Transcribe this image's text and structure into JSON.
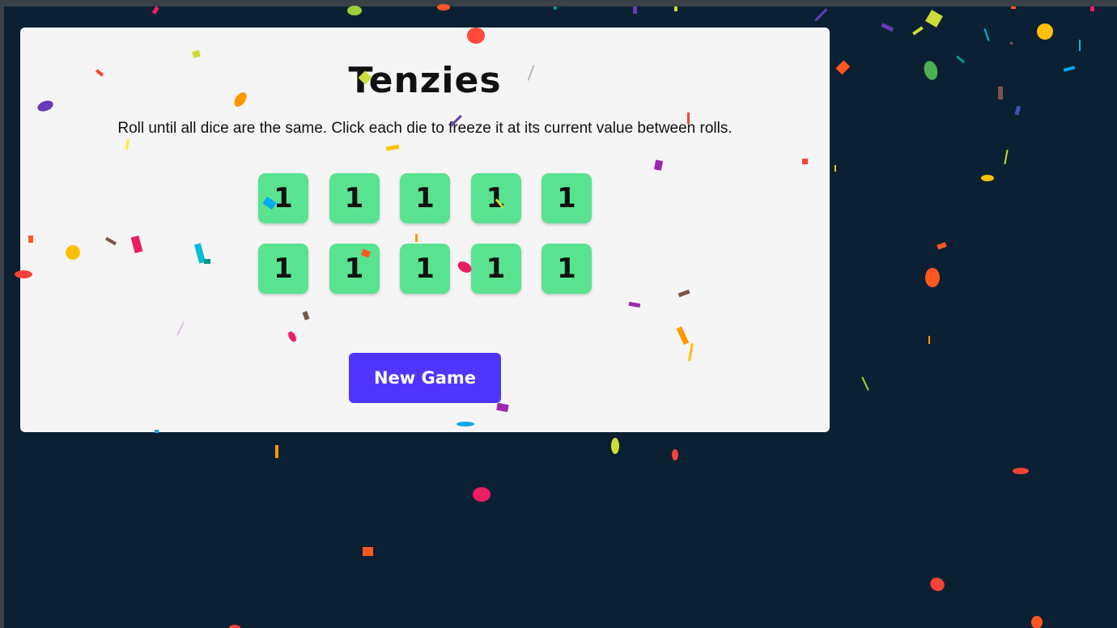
{
  "game": {
    "title": "Tenzies",
    "instructions": "Roll until all dice are the same. Click each die to freeze it at its current value between rolls.",
    "dice": [
      1,
      1,
      1,
      1,
      1,
      1,
      1,
      1,
      1,
      1
    ],
    "button_label": "New Game",
    "status": "won"
  },
  "colors": {
    "background": "#0b2133",
    "card": "#f5f5f5",
    "die_held": "#59e391",
    "button": "#5035ff"
  }
}
